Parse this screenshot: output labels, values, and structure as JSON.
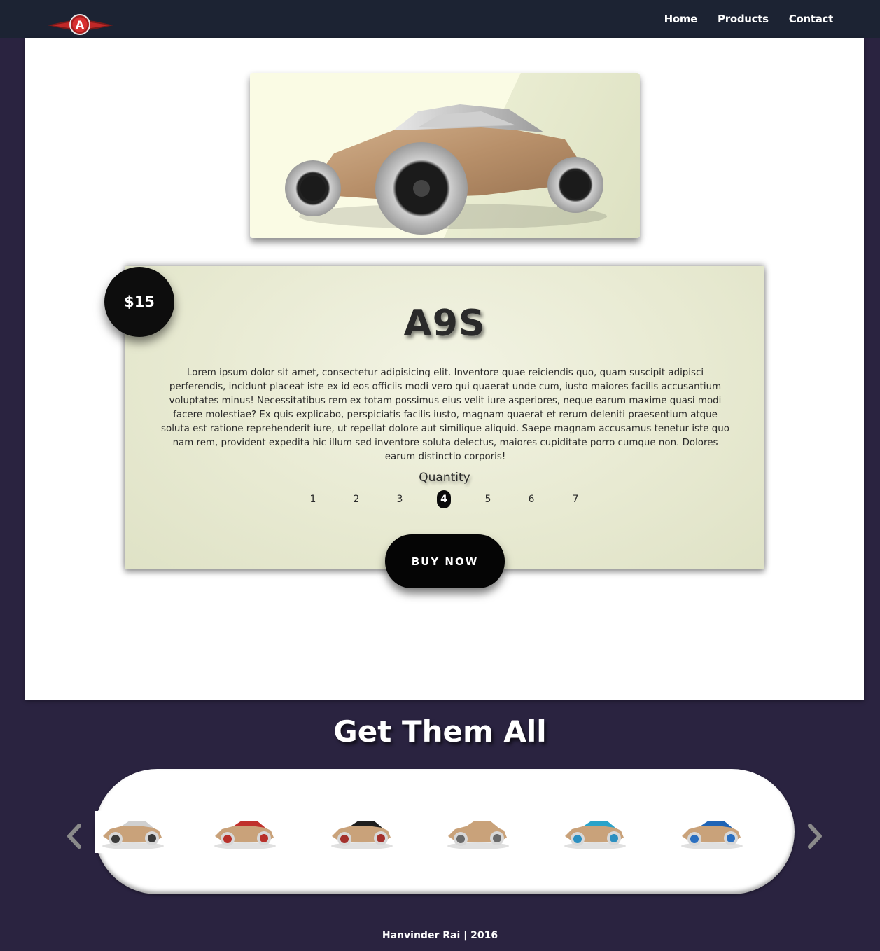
{
  "nav": {
    "links": [
      "Home",
      "Products",
      "Contact"
    ],
    "logo_letter": "A"
  },
  "product": {
    "price": "$15",
    "name": "A9S",
    "description": "Lorem ipsum dolor sit amet, consectetur adipisicing elit. Inventore quae reiciendis quo, quam suscipit adipisci perferendis, incidunt placeat iste ex id eos officiis modi vero qui quaerat unde cum, iusto maiores facilis accusantium voluptates minus! Necessitatibus rem ex totam possimus eius velit iure asperiores, neque earum maxime quasi modi facere molestiae? Ex quis explicabo, perspiciatis facilis iusto, magnam quaerat et rerum deleniti praesentium atque soluta est ratione reprehenderit iure, ut repellat dolore aut similique aliquid. Saepe magnam accusamus tenetur iste quo nam rem, provident expedita hic illum sed inventore soluta delectus, maiores cupiditate porro cumque non. Dolores earum distinctio corporis!",
    "quantity_label": "Quantity",
    "quantity_options": [
      "1",
      "2",
      "3",
      "4",
      "5",
      "6",
      "7"
    ],
    "quantity_selected": "4",
    "buy_label": "BUY NOW"
  },
  "gallery": {
    "title": "Get Them All",
    "cars": [
      {
        "body": "#c9a27a",
        "roof": "#d0d0d0",
        "wheel": "#3a3a3a"
      },
      {
        "body": "#c9a27a",
        "roof": "#c0302c",
        "wheel": "#b8302a"
      },
      {
        "body": "#c9a27a",
        "roof": "#1e1e1e",
        "wheel": "#a3302c"
      },
      {
        "body": "#c9a27a",
        "roof": "#c9a27a",
        "wheel": "#6a6a6a"
      },
      {
        "body": "#c9a27a",
        "roof": "#2aa3c9",
        "wheel": "#2b8fc0"
      },
      {
        "body": "#c9a27a",
        "roof": "#1f64b6",
        "wheel": "#2a6fc0"
      }
    ]
  },
  "footer": {
    "text": "Hanvinder Rai | 2016"
  },
  "colors": {
    "navbar": "#1c2333",
    "page_bg": "#2a2340",
    "accent_black": "#0a0a0a"
  }
}
